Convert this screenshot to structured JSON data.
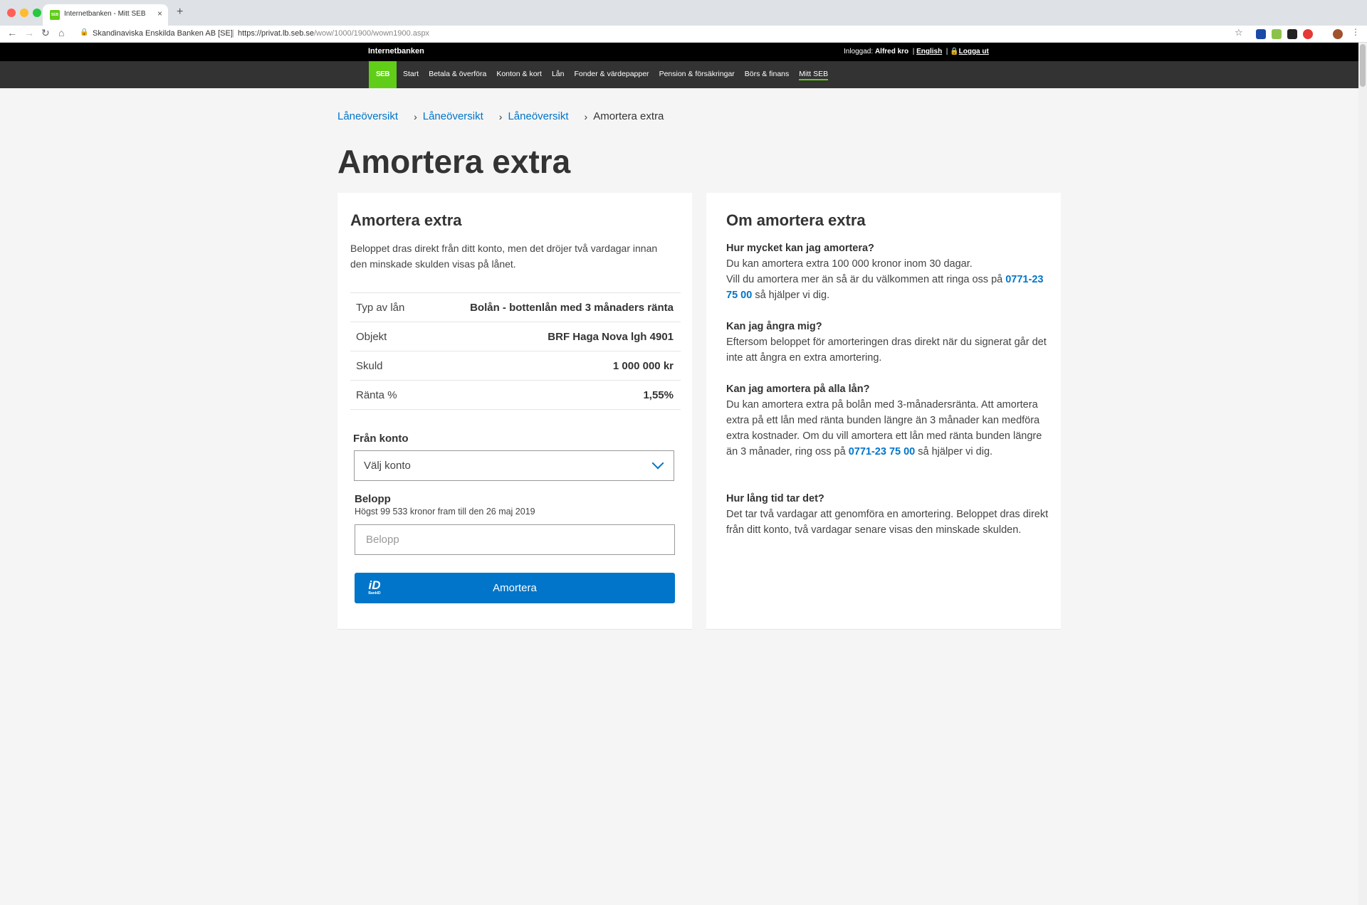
{
  "browser": {
    "tab_title": "Internetbanken - Mitt SEB",
    "tab_close": "×",
    "new_tab": "+",
    "favicon_text": "SEB",
    "org_label": "Skandinaviska Enskilda Banken AB [SE]",
    "url_host": "https://privat.lb.seb.se",
    "url_path": "/wow/1000/1900/wown1900.aspx"
  },
  "header": {
    "brand": "Internetbanken",
    "logged_in_label": "Inloggad:",
    "user_name": "Alfred kro",
    "english_link": "English",
    "logout_link": "Logga ut",
    "logo_text": "SEB",
    "nav": [
      "Start",
      "Betala & överföra",
      "Konton & kort",
      "Lån",
      "Fonder & värdepapper",
      "Pension & försäkringar",
      "Börs & finans",
      "Mitt SEB"
    ]
  },
  "breadcrumb": [
    "Låneöversikt",
    "Låneöversikt",
    "Låneöversikt",
    "Amortera extra"
  ],
  "page_title": "Amortera extra",
  "form_card": {
    "title": "Amortera extra",
    "intro": "Beloppet dras direkt från ditt konto, men det dröjer två vardagar innan den minskade skulden visas på lånet.",
    "rows": [
      {
        "label": "Typ av lån",
        "value": "Bolån - bottenlån med 3 månaders ränta"
      },
      {
        "label": "Objekt",
        "value": "BRF Haga Nova lgh 4901"
      },
      {
        "label": "Skuld",
        "value": "1 000 000 kr"
      },
      {
        "label": "Ränta %",
        "value": "1,55%"
      }
    ],
    "from_account_label": "Från konto",
    "from_account_value": "Välj konto",
    "amount_label": "Belopp",
    "amount_hint": "Högst 99 533 kronor fram till den 26 maj 2019",
    "amount_placeholder": "Belopp",
    "submit_label": "Amortera",
    "bankid_label": "BankID"
  },
  "info_card": {
    "title": "Om amortera extra",
    "faq": [
      {
        "q": "Hur mycket kan jag amortera?",
        "a1": "Du kan amortera extra 100 000 kronor inom 30 dagar.",
        "a2": "Vill du amortera mer än så är du välkommen att ringa oss på",
        "phone": "0771-23 75 00",
        "a3": "så hjälper vi dig."
      },
      {
        "q": "Kan jag ångra mig?",
        "a": "Eftersom beloppet för amorteringen dras direkt när du signerat går det inte att ångra en extra amortering."
      },
      {
        "q": "Kan jag amortera på alla lån?",
        "a1": "Du kan amortera extra på bolån med 3-månadersränta. Att amortera extra på ett lån med ränta bunden längre än 3 månader kan medföra extra kostnader. Om du vill amortera ett lån med ränta bunden längre än 3 månader, ring oss på",
        "phone": "0771-23 75 00",
        "a2": "så hjälper vi dig."
      },
      {
        "q": "Hur lång tid tar det?",
        "a": "Det tar två vardagar att genomföra en amortering. Beloppet dras direkt från ditt konto, två vardagar senare visas den minskade skulden."
      }
    ]
  }
}
